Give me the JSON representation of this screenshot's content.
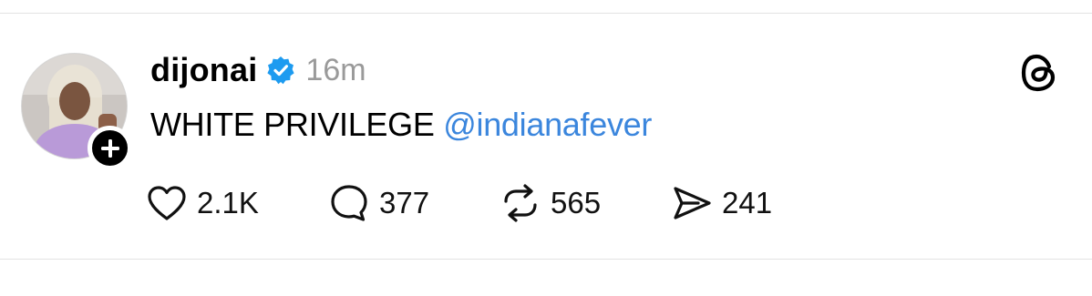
{
  "post": {
    "username": "dijonai",
    "time_ago": "16m",
    "text": "WHITE PRIVILEGE",
    "mention": "@indianafever"
  },
  "actions": {
    "likes": "2.1K",
    "replies": "377",
    "reposts": "565",
    "shares": "241"
  },
  "icons": {
    "verified": "verified-badge-icon",
    "follow": "plus-icon",
    "app": "threads-logo-icon",
    "like": "heart-icon",
    "reply": "speech-bubble-icon",
    "repost": "repost-arrows-icon",
    "share": "paper-plane-icon"
  },
  "colors": {
    "mention": "#3b86dd",
    "verified": "#1d9bf0",
    "muted": "#9a9a9a"
  }
}
